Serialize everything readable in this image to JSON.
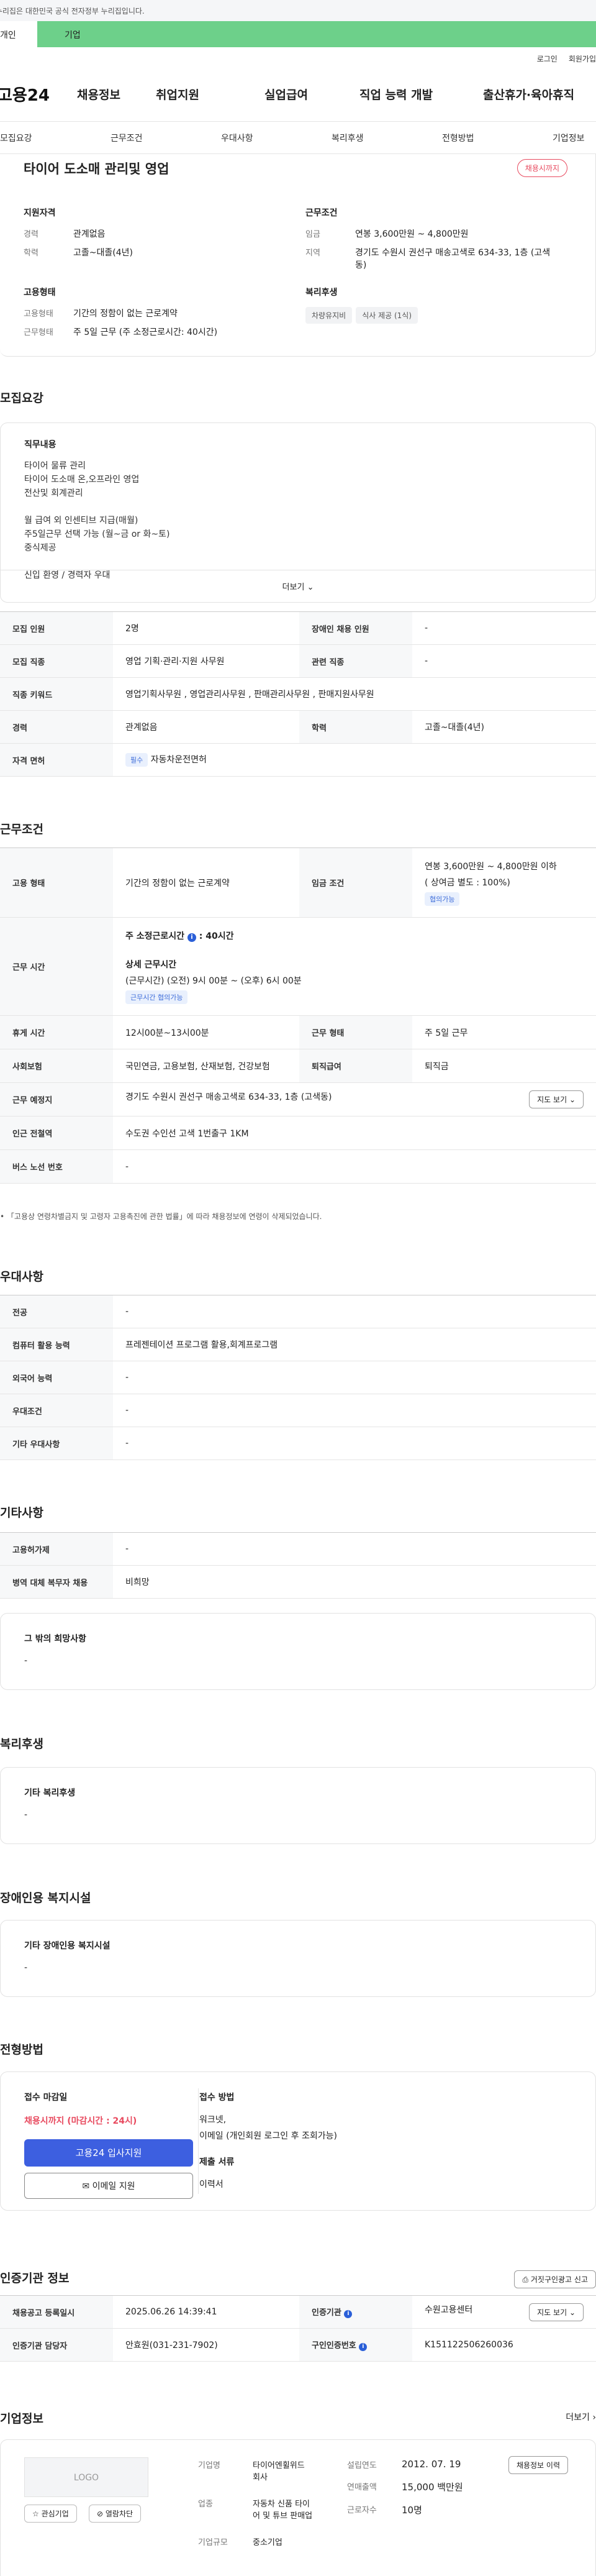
{
  "topbar": {
    "notice": "이 누리집은 대한민국 공식 전자정부 누리집입니다."
  },
  "mode": {
    "personal": "개인",
    "company": "기업"
  },
  "util": {
    "login": "로그인",
    "join": "회원가입"
  },
  "gnb": {
    "logo": "고용24",
    "menu": [
      "채용정보",
      "취업지원",
      "실업급여",
      "직업 능력 개발",
      "출산휴가·육아휴직"
    ]
  },
  "subnav": [
    "모집요강",
    "근무조건",
    "우대사항",
    "복리후생",
    "전형방법",
    "기업정보"
  ],
  "summary": {
    "title": "타이어 도소매 관리및 영업",
    "status": "채용시까지",
    "qual_title": "지원자격",
    "qual": [
      {
        "k": "경력",
        "v": "관계없음"
      },
      {
        "k": "학력",
        "v": "고졸~대졸(4년)"
      }
    ],
    "emp_title": "고용형태",
    "emp": [
      {
        "k": "고용형태",
        "v": "기간의 정함이 없는 근로계약"
      },
      {
        "k": "근무형태",
        "v": "주 5일 근무 (주 소정근로시간: 40시간)"
      }
    ],
    "cond_title": "근무조건",
    "cond": [
      {
        "k": "임금",
        "v": "연봉 3,600만원 ~ 4,800만원"
      },
      {
        "k": "지역",
        "v": "경기도 수원시 권선구 매송고색로 634-33, 1층 (고색동)"
      }
    ],
    "welfare_title": "복리후생",
    "welfare_tags": [
      "차량유지비",
      "식사 제공 (1식)"
    ]
  },
  "recruit": {
    "title": "모집요강",
    "duty_title": "직무내용",
    "duty_lines": [
      "타이어 물류 관리",
      "타이어 도소매 온,오프라인 영업",
      "전산및 회계관리",
      "",
      "월 급여 외 인센티브 지급(매월)",
      "주5일근무 선택 가능 (월~금 or 화~토)",
      "중식제공",
      "",
      "신입 환영 / 경력자 우대"
    ],
    "more": "더보기",
    "rows": [
      {
        "k1": "모집 인원",
        "v1": "2명",
        "k2": "장애인 채용 인원",
        "v2": "-"
      },
      {
        "k1": "모집 직종",
        "v1": "영업 기획·관리·지원 사무원",
        "k2": "관련 직종",
        "v2": "-"
      },
      {
        "k1": "직종 키워드",
        "v1": "영업기획사무원 , 영업관리사무원 , 판매관리사무원 , 판매지원사무원"
      },
      {
        "k1": "경력",
        "v1": "관계없음",
        "k2": "학력",
        "v2": "고졸~대졸(4년)"
      },
      {
        "k1": "자격 면허",
        "badge": "필수",
        "v1": "자동차운전면허"
      }
    ]
  },
  "work": {
    "title": "근무조건",
    "emp_k": "고용 형태",
    "emp_v": "기간의 정함이 없는 근로계약",
    "wage_k": "임금 조건",
    "wage_v": "연봉 3,600만원 ~ 4,800만원 이하",
    "wage_sub": "( 상여금 별도 : 100%)",
    "wage_pill": "협의가능",
    "time_k": "근무 시간",
    "time_main": "주 소정근로시간",
    "time_hours": "40시간",
    "time_detail_title": "상세 근무시간",
    "time_detail": "(근무시간) (오전) 9시 00분 ~ (오후) 6시 00분",
    "time_pill": "근무시간 협의가능",
    "rest_k": "휴게 시간",
    "rest_v": "12시00분~13시00분",
    "form_k": "근무 형태",
    "form_v": "주 5일 근무",
    "ins_k": "사회보험",
    "ins_v": "국민연금, 고용보험, 산재보험, 건강보험",
    "ret_k": "퇴직급여",
    "ret_v": "퇴직금",
    "loc_k": "근무 예정지",
    "loc_v": "경기도 수원시 권선구 매송고색로 634-33, 1층 (고색동)",
    "map_btn": "지도 보기",
    "sub_k": "인근 전철역",
    "sub_v": "수도권 수인선 고색 1번출구 1KM",
    "bus_k": "버스 노선 번호",
    "bus_v": "-",
    "note": "「고용상 연령차별금지 및 고령자 고용촉진에 관한 법률」에 따라 채용정보에 연령이 삭제되었습니다."
  },
  "pref": {
    "title": "우대사항",
    "rows": [
      {
        "k": "전공",
        "v": "-"
      },
      {
        "k": "컴퓨터 활용 능력",
        "v": "프레젠테이션 프로그램 활용,회계프로그램"
      },
      {
        "k": "외국어 능력",
        "v": "-"
      },
      {
        "k": "우대조건",
        "v": "-"
      },
      {
        "k": "기타 우대사항",
        "v": "-"
      }
    ]
  },
  "etc": {
    "title": "기타사항",
    "rows": [
      {
        "k": "고용허가제",
        "v": "-"
      },
      {
        "k": "병역 대체 복무자 채용",
        "v": "비희망"
      }
    ],
    "hope_title": "그 밖의 희망사항",
    "hope_v": "-"
  },
  "welfare": {
    "title": "복리후생",
    "sub": "기타 복리후생",
    "v": "-"
  },
  "disabled": {
    "title": "장애인용 복지시설",
    "sub": "기타 장애인용 복지시설",
    "v": "-"
  },
  "process": {
    "title": "전형방법",
    "deadline_title": "접수 마감일",
    "deadline_v": "채용시까지 (마감시간 : 24시)",
    "apply_btn": "고용24 입사지원",
    "email_btn": "이메일 지원",
    "method_title": "접수 방법",
    "method_v": "워크넷,",
    "method_v2": "이메일 (개인회원 로그인 후 조회가능)",
    "docs_title": "제출 서류",
    "docs_v": "이력서"
  },
  "cert": {
    "title": "인증기관 정보",
    "report_btn": "거짓구인광고 신고",
    "rows": [
      {
        "k1": "채용공고 등록일시",
        "v1": "2025.06.26 14:39:41",
        "k2": "인증기관",
        "v2": "수원고용센터",
        "btn": "지도 보기"
      },
      {
        "k1": "인증기관 담당자",
        "v1": "안효원(031-231-7902)",
        "k2": "구인인증번호",
        "v2": "K151122506260036"
      }
    ]
  },
  "company": {
    "title": "기업정보",
    "more": "더보기",
    "logo": "LOGO",
    "fav_btn": "관심기업",
    "block_btn": "열람차단",
    "name_k": "기업명",
    "name_v": "타이어엔휠위드",
    "name_v2": "회사",
    "ind_k": "업종",
    "ind_v": "자동차 신품 타이",
    "ind_v2": "어 및 튜브 판매업",
    "size_k": "기업규모",
    "size_v": "중소기업",
    "est_k": "설립연도",
    "est_v": "2012. 07. 19",
    "sales_k": "연매출액",
    "sales_v": "15,000 백만원",
    "emp_k": "근로자수",
    "emp_v": "10명",
    "hire_btn": "채용정보 이력"
  }
}
